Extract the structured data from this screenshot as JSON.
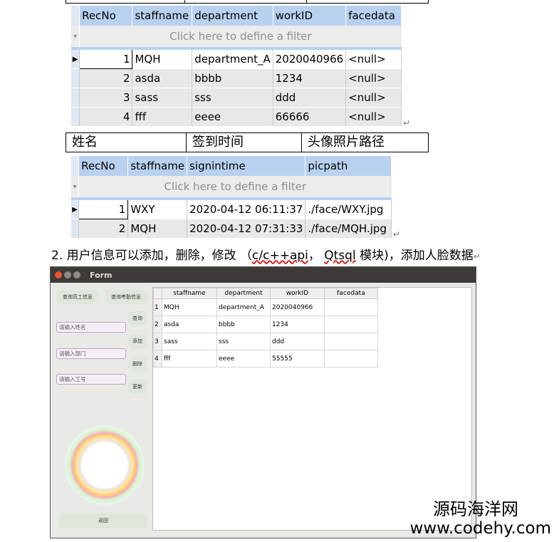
{
  "table1": {
    "filter_text": "Click here to define a filter",
    "columns": [
      "RecNo",
      "staffname",
      "department",
      "workID",
      "facedata"
    ],
    "rows": [
      [
        "1",
        "MQH",
        "department_A",
        "2020040966",
        "<null>"
      ],
      [
        "2",
        "asda",
        "bbbb",
        "1234",
        "<null>"
      ],
      [
        "3",
        "sass",
        "sss",
        "ddd",
        "<null>"
      ],
      [
        "4",
        "fff",
        "eeee",
        "66666",
        "<null>"
      ]
    ]
  },
  "cn_header": [
    "姓名",
    "签到时间",
    "头像照片路径"
  ],
  "table2": {
    "filter_text": "Click here to define a filter",
    "columns": [
      "RecNo",
      "staffname",
      "signintime",
      "picpath"
    ],
    "rows": [
      [
        "1",
        "WXY",
        "2020-04-12 06:11:37",
        "./face/WXY.jpg"
      ],
      [
        "2",
        "MQH",
        "2020-04-12 07:31:33",
        "./face/MQH.jpg"
      ]
    ]
  },
  "heading": {
    "prefix": "2. 用户信息可以添加，删除，修改 （",
    "api": "c/c++api",
    "mid": "， ",
    "qtsql": "Qtsql",
    "suffix": " 模块)，添加人脸数据"
  },
  "app": {
    "title": "Form",
    "buttons": {
      "query_staff": "查询员工信息",
      "query_attendance": "查询考勤信息",
      "query": "查询",
      "add": "添加",
      "delete": "删除",
      "update": "更新",
      "back": "返回"
    },
    "placeholders": {
      "name": "请输入姓名",
      "department": "请输入部门",
      "work_id": "请输入工号"
    },
    "columns": [
      "staffname",
      "department",
      "workID",
      "facedata"
    ],
    "rows": [
      [
        "1",
        "MQH",
        "department_A",
        "2020040966",
        ""
      ],
      [
        "2",
        "asda",
        "bbbb",
        "1234",
        ""
      ],
      [
        "3",
        "sass",
        "sss",
        "ddd",
        ""
      ],
      [
        "4",
        "fff",
        "eeee",
        "55555",
        ""
      ]
    ]
  },
  "watermark": {
    "line1": "源码海洋网",
    "line2": "www.codehy.com"
  },
  "colors": {
    "grid_header": "#b8d1ef",
    "titlebar": "#3c3b37",
    "close_btn": "#e9552d"
  }
}
